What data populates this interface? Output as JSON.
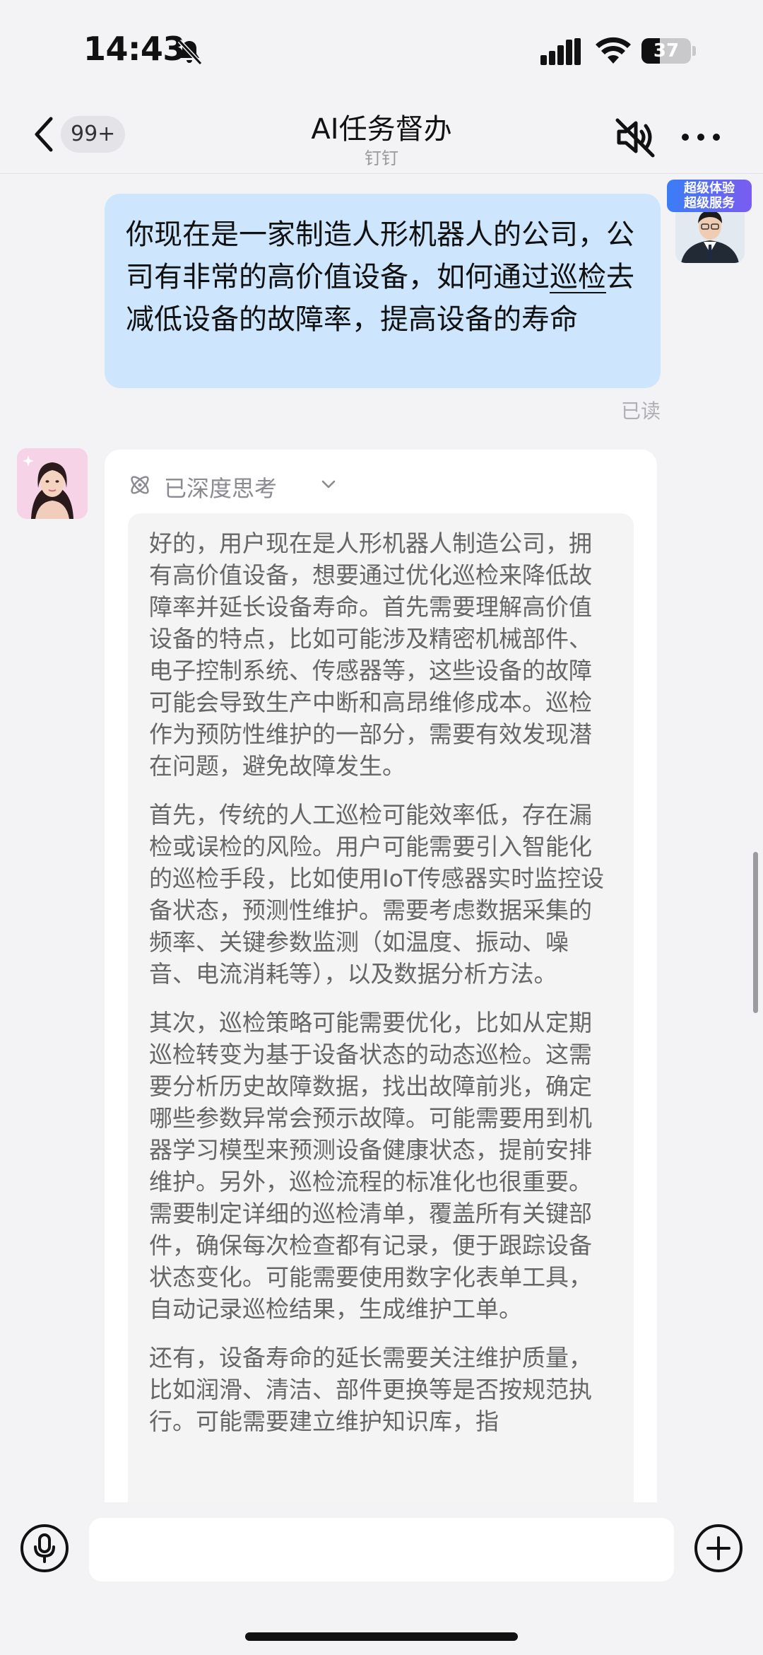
{
  "status_bar": {
    "time": "14:43",
    "battery": "37",
    "battery_level": 0.37
  },
  "nav": {
    "unread_count": "99+",
    "title": "AI任务督办",
    "subtitle": "钉钉"
  },
  "user_message": {
    "text_part1": "你现在是一家制造人形机器人的公司，公司有非常的高价值设备，如何通过",
    "text_underlined": "巡检",
    "text_part2": "去减低设备的故障率，提高设备的寿命",
    "read_status": "已读",
    "avatar_badge_line1": "超级体验",
    "avatar_badge_line2": "超级服务"
  },
  "ai_message": {
    "thinking_label": "已深度思考",
    "paragraphs": [
      "好的，用户现在是人形机器人制造公司，拥有高价值设备，想要通过优化巡检来降低故障率并延长设备寿命。首先需要理解高价值设备的特点，比如可能涉及精密机械部件、电子控制系统、传感器等，这些设备的故障可能会导致生产中断和高昂维修成本。巡检作为预防性维护的一部分，需要有效发现潜在问题，避免故障发生。",
      "首先，传统的人工巡检可能效率低，存在漏检或误检的风险。用户可能需要引入智能化的巡检手段，比如使用IoT传感器实时监控设备状态，预测性维护。需要考虑数据采集的频率、关键参数监测（如温度、振动、噪音、电流消耗等），以及数据分析方法。",
      "其次，巡检策略可能需要优化，比如从定期巡检转变为基于设备状态的动态巡检。这需要分析历史故障数据，找出故障前兆，确定哪些参数异常会预示故障。可能需要用到机器学习模型来预测设备健康状态，提前安排维护。另外，巡检流程的标准化也很重要。需要制定详细的巡检清单，覆盖所有关键部件，确保每次检查都有记录，便于跟踪设备状态变化。可能需要使用数字化表单工具，自动记录巡检结果，生成维护工单。",
      "还有，设备寿命的延长需要关注维护质量，比如润滑、清洁、部件更换等是否按规范执行。可能需要建立维护知识库，指"
    ]
  },
  "input": {
    "placeholder": "",
    "value": ""
  }
}
